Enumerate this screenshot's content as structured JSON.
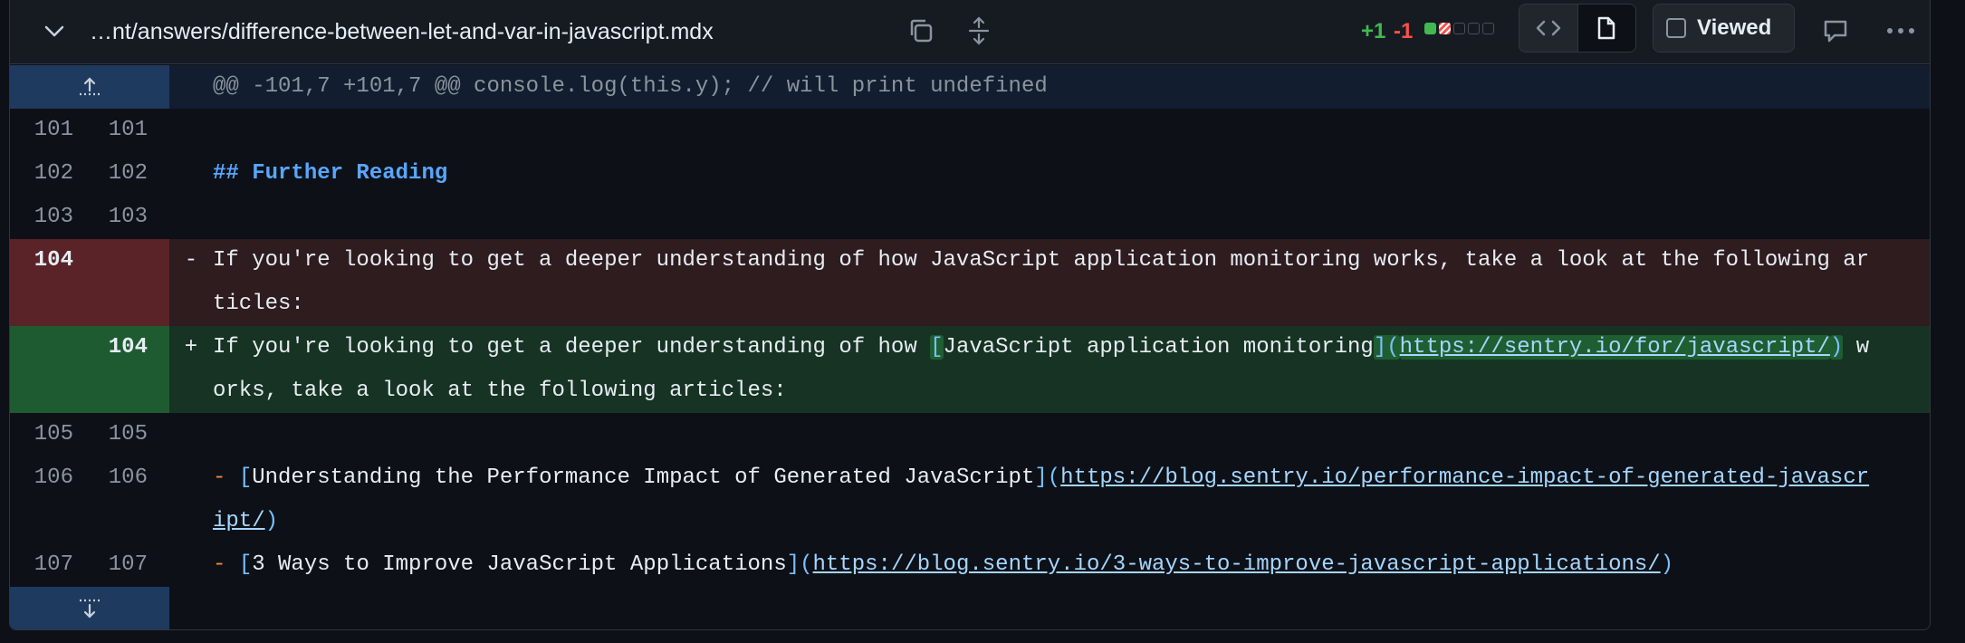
{
  "header": {
    "file_path": "…nt/answers/difference-between-let-and-var-in-javascript.mdx",
    "additions": "+1",
    "deletions": "-1",
    "viewed_label": "Viewed",
    "stat_colors": [
      "#3fb950",
      "#f85149",
      "#30363d",
      "#30363d",
      "#30363d"
    ]
  },
  "hunk": {
    "header": "@@ -101,7 +101,7 @@ console.log(this.y); // will print undefined"
  },
  "lines": {
    "l101": {
      "old": "101",
      "new": "101",
      "text": ""
    },
    "l102": {
      "old": "102",
      "new": "102",
      "text": "## Further Reading"
    },
    "l103": {
      "old": "103",
      "new": "103",
      "text": ""
    },
    "del104": {
      "old": "104",
      "new": "",
      "marker": "-",
      "text": "If you're looking to get a deeper understanding of how JavaScript application monitoring works, take a look at the following articles:"
    },
    "add104": {
      "old": "",
      "new": "104",
      "marker": "+",
      "pre": "If you're looking to get a deeper understanding of how ",
      "open_bracket": "[",
      "link_text": "JavaScript application monitoring",
      "close_bracket": "](",
      "url": "https://sentry.io/for/javascript/",
      "close_paren": ")",
      "post": " works, take a look at the following articles:"
    },
    "l105": {
      "old": "105",
      "new": "105",
      "text": ""
    },
    "l106": {
      "old": "106",
      "new": "106",
      "dash": "-",
      "open": "[",
      "title": "Understanding the Performance Impact of Generated JavaScript",
      "mid": "](",
      "url": "https://blog.sentry.io/performance-impact-of-generated-javascript/",
      "close": ")"
    },
    "l107": {
      "old": "107",
      "new": "107",
      "dash": "-",
      "open": "[",
      "title": "3 Ways to Improve JavaScript Applications",
      "mid": "](",
      "url": "https://blog.sentry.io/3-ways-to-improve-javascript-applications/",
      "close": ")"
    }
  }
}
